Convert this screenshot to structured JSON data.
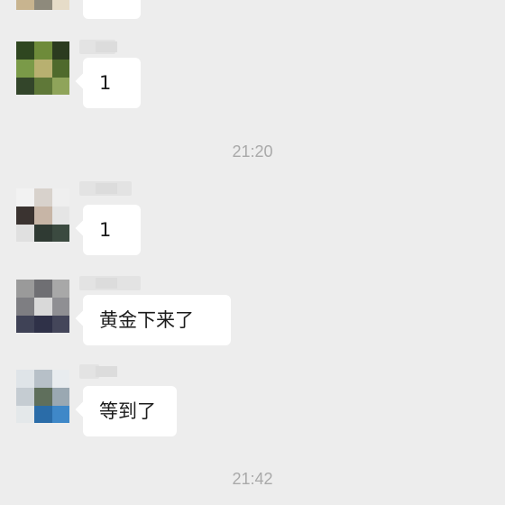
{
  "chat": {
    "timestamps": [
      "21:20",
      "21:42"
    ],
    "messages": [
      {
        "text": "",
        "avatar": "blurred-avatar"
      },
      {
        "text": "1",
        "avatar": "blurred-avatar"
      },
      {
        "text": "1",
        "avatar": "blurred-avatar"
      },
      {
        "text": "黄金下来了",
        "avatar": "blurred-avatar"
      },
      {
        "text": "等到了",
        "avatar": "blurred-avatar"
      }
    ]
  },
  "colors": {
    "background": "#ededed",
    "bubble": "#ffffff",
    "timestamp": "#a9a9a9",
    "text": "#1b1b1b"
  }
}
